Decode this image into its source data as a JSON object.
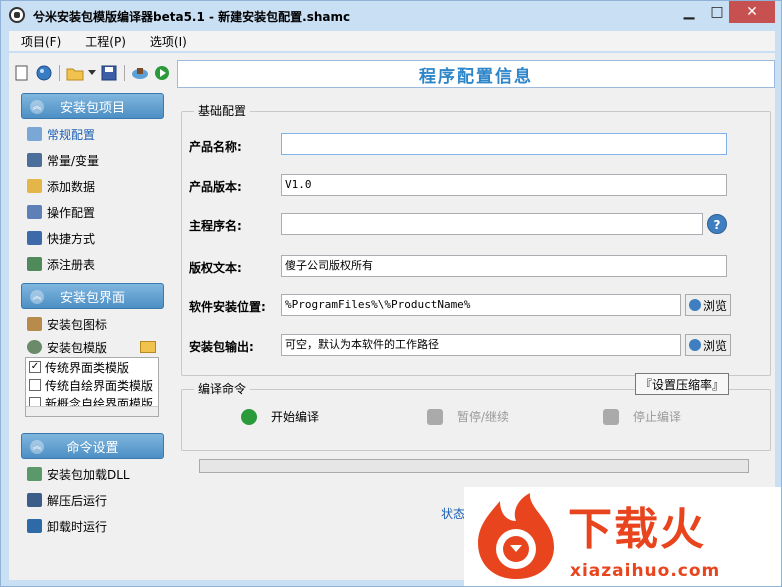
{
  "window": {
    "title": "兮米安装包模版编译器beta5.1 - 新建安装包配置.shamc",
    "min": "▁",
    "max": "□",
    "close": "✕"
  },
  "menu": [
    "项目(F)",
    "工程(P)",
    "选项(I)"
  ],
  "sidebar": {
    "section1": {
      "title": "安装包项目",
      "items": [
        "常规配置",
        "常量/变量",
        "添加数据",
        "操作配置",
        "快捷方式",
        "添注册表"
      ]
    },
    "section2": {
      "title": "安装包界面",
      "items": [
        "安装包图标",
        "安装包模版"
      ],
      "templates": [
        {
          "label": "传统界面类模版",
          "checked": true
        },
        {
          "label": "传统自绘界面类模版",
          "checked": false
        },
        {
          "label": "新概念自绘界面模版",
          "checked": false
        }
      ]
    },
    "section3": {
      "title": "命令设置",
      "items": [
        "安装包加载DLL",
        "解压后运行",
        "卸载时运行"
      ]
    }
  },
  "main": {
    "title": "程序配置信息",
    "basic": {
      "legend": "基础配置",
      "product_name_label": "产品名称:",
      "product_name_value": "",
      "version_label": "产品版本:",
      "version_value": "V1.0",
      "main_prog_label": "主程序名:",
      "main_prog_value": "",
      "help": "?",
      "copyright_label": "版权文本:",
      "copyright_value": "傻子公司版权所有",
      "install_path_label": "软件安装位置:",
      "install_path_value": "%ProgramFiles%\\%ProductName%",
      "output_label": "安装包输出:",
      "output_value": "可空，默认为本软件的工作路径",
      "browse": "浏览"
    },
    "compile": {
      "legend": "编译命令",
      "set_compression": "『设置压缩率』",
      "start": "开始编译",
      "pause": "暂停/继续",
      "stop": "停止编译"
    },
    "status": "状态"
  },
  "watermark": {
    "cn": "下载火",
    "en": "xiazaihuo.com"
  }
}
